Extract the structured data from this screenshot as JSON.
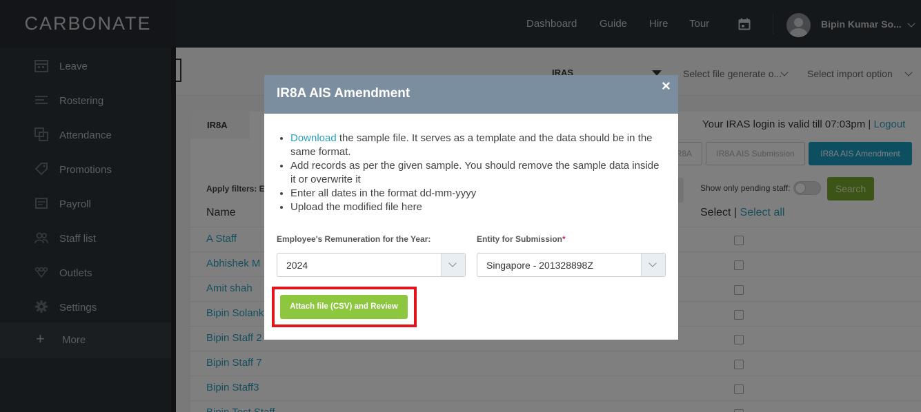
{
  "app": {
    "logo": "CARBONATE"
  },
  "nav": {
    "dashboard": "Dashboard",
    "guide": "Guide",
    "hire": "Hire",
    "tour": "Tour",
    "user_name": "Bipin Kumar So..."
  },
  "sidebar": {
    "items": [
      {
        "label": "Leave",
        "icon": "calendar-icon"
      },
      {
        "label": "Rostering",
        "icon": "roster-icon"
      },
      {
        "label": "Attendance",
        "icon": "attendance-icon"
      },
      {
        "label": "Promotions",
        "icon": "tag-icon"
      },
      {
        "label": "Payroll",
        "icon": "payroll-icon"
      },
      {
        "label": "Staff list",
        "icon": "users-icon"
      },
      {
        "label": "Outlets",
        "icon": "outlets-icon"
      },
      {
        "label": "Settings",
        "icon": "gear-icon"
      }
    ],
    "more": "More"
  },
  "toolbar": {
    "module": "IRAS",
    "file_generate": "Select file generate o...",
    "import_option": "Select import option"
  },
  "content": {
    "tab": "IR8A",
    "login_info": "Your IRAS login is valid till 07:03pm |",
    "logout": "Logout",
    "buttons": {
      "ir8a_partial": "R8A",
      "ais_submission": "IR8A AIS Submission",
      "ais_amendment": "IR8A AIS Amendment"
    },
    "filters_label": "Apply filters: E",
    "pending_label": "Show only pending staff:",
    "search": "Search",
    "col_name": "Name",
    "col_select": "Select |",
    "select_all": "Select all",
    "rows": [
      "A Staff",
      "Abhishek M",
      "Amit shah",
      "Bipin Solank",
      "Bipin Staff 2",
      "Bipin Staff 7",
      "Bipin Staff3",
      "Bipin Test Staff"
    ]
  },
  "modal": {
    "title": "IR8A AIS Amendment",
    "close": "×",
    "instructions": {
      "download_link": "Download",
      "line1_rest": " the sample file. It serves as a template and the data should be in the same format.",
      "line2": "Add records as per the given sample. You should remove the sample data inside it or overwrite it",
      "line3": "Enter all dates in the format dd-mm-yyyy",
      "line4": "Upload the modified file here"
    },
    "year_label": "Employee's Remuneration for the Year:",
    "year_value": "2024",
    "entity_label": "Entity for Submission",
    "entity_required": "*",
    "entity_value": "Singapore - 201328898Z",
    "attach_button": "Attach file (CSV) and Review"
  }
}
